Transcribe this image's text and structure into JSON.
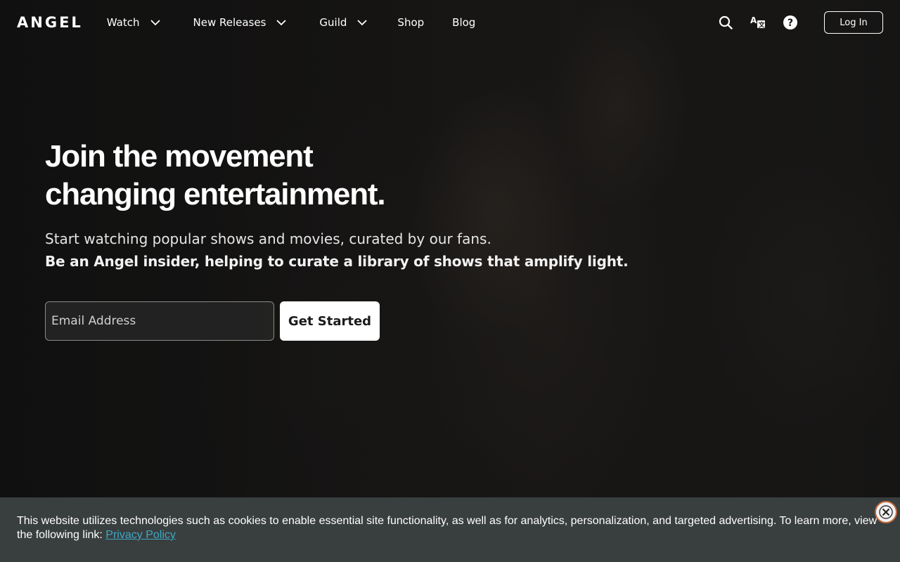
{
  "brand": {
    "logo": "ANGEL"
  },
  "nav": {
    "items": [
      {
        "label": "Watch",
        "has_dropdown": true
      },
      {
        "label": "New Releases",
        "has_dropdown": true
      },
      {
        "label": "Guild",
        "has_dropdown": true
      },
      {
        "label": "Shop",
        "has_dropdown": false
      },
      {
        "label": "Blog",
        "has_dropdown": false
      }
    ],
    "icons": [
      "search-icon",
      "translate-icon",
      "help-icon"
    ],
    "login_label": "Log In"
  },
  "hero": {
    "title_line1": "Join the movement",
    "title_line2": "changing entertainment.",
    "subtitle": "Start watching popular shows and movies, curated by our fans.",
    "subtitle_bold": "Be an Angel insider, helping to curate a library of shows that amplify light.",
    "email_placeholder": "Email Address",
    "cta_label": "Get Started"
  },
  "cookie_banner": {
    "text": "This website utilizes technologies such as cookies to enable essential site functionality, as well as for analytics, personalization, and targeted advertising. To learn more, view the following link: ",
    "link_label": "Privacy Policy",
    "link_color": "#3fa9c4",
    "background": "#393e3f"
  }
}
